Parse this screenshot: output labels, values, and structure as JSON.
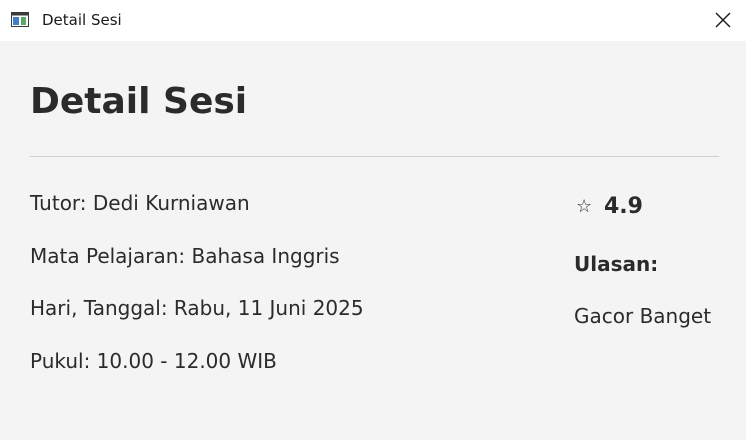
{
  "window": {
    "title": "Detail Sesi",
    "icon": "app-window-icon",
    "close_icon": "close-icon"
  },
  "page": {
    "title": "Detail Sesi"
  },
  "details": {
    "tutor": "Tutor: Dedi Kurniawan",
    "subject": "Mata Pelajaran: Bahasa Inggris",
    "date": "Hari, Tanggal: Rabu, 11 Juni 2025",
    "time": "Pukul: 10.00 - 12.00 WIB"
  },
  "rating": {
    "icon": "☆",
    "value": "4.9"
  },
  "review": {
    "heading": "Ulasan:",
    "text": "Gacor Banget"
  }
}
